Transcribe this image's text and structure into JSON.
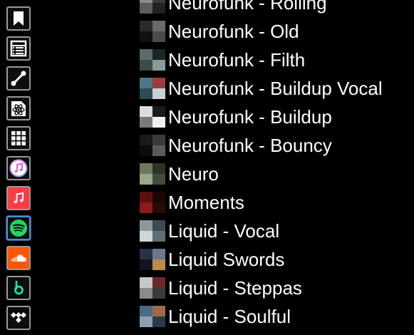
{
  "sidebar": {
    "buttons": [
      {
        "name": "bookmark-icon",
        "title": "Bookmarks",
        "bg": "#0d0d0d"
      },
      {
        "name": "list-icon",
        "title": "List",
        "bg": "#0d0d0d"
      },
      {
        "name": "connection-icon",
        "title": "Connections",
        "bg": "#0d0d0d"
      },
      {
        "name": "atom-icon",
        "title": "Atom",
        "bg": "#0d0d0d"
      },
      {
        "name": "grid-icon",
        "title": "Grid",
        "bg": "#0d0d0d"
      },
      {
        "name": "itunes-icon",
        "title": "iTunes",
        "bg": "#0d0d0d"
      },
      {
        "name": "apple-music-icon",
        "title": "Apple Music",
        "bg": "#fc3c44"
      },
      {
        "name": "spotify-icon",
        "title": "Spotify",
        "bg": "#0d0d0d",
        "active": true
      },
      {
        "name": "soundcloud-icon",
        "title": "SoundCloud",
        "bg": "#ff5500"
      },
      {
        "name": "beatport-icon",
        "title": "Beatport",
        "bg": "#0d0d0d"
      },
      {
        "name": "tidal-icon",
        "title": "Tidal",
        "bg": "#0d0d0d"
      }
    ]
  },
  "playlists": [
    {
      "label": "Neurofunk - Rolling",
      "colors": [
        "#8a8a8a",
        "#3a3a3a",
        "#5c5c5c",
        "#222222"
      ]
    },
    {
      "label": "Neurofunk - Old",
      "colors": [
        "#2a2a2a",
        "#6a6a6a",
        "#111111",
        "#4b4b4b"
      ]
    },
    {
      "label": "Neurofunk - Filth",
      "colors": [
        "#5d6b6a",
        "#1c2525",
        "#3c4a48",
        "#8a9a98"
      ]
    },
    {
      "label": "Neurofunk - Buildup Vocal",
      "colors": [
        "#4a7a86",
        "#a13a3a",
        "#2d4b55",
        "#c8d2d6"
      ]
    },
    {
      "label": "Neurofunk - Buildup",
      "colors": [
        "#dcdcdc",
        "#1a1a1a",
        "#7a7a7a",
        "#efefef"
      ]
    },
    {
      "label": "Neurofunk - Bouncy",
      "colors": [
        "#1a1a1a",
        "#3b3b3b",
        "#0c0c0c",
        "#5a5a5a"
      ]
    },
    {
      "label": "Neuro",
      "colors": [
        "#6b7a5a",
        "#2d3328",
        "#9aa58a",
        "#444c3a"
      ]
    },
    {
      "label": "Moments",
      "colors": [
        "#5a1010",
        "#1a0505",
        "#8a1c1c",
        "#2a0808"
      ]
    },
    {
      "label": "Liquid - Vocal",
      "colors": [
        "#8a9a9a",
        "#3d4a50",
        "#cfd6d8",
        "#5f6f72"
      ]
    },
    {
      "label": "Liquid Swords",
      "colors": [
        "#2a3344",
        "#6a7a8a",
        "#101520",
        "#c08a4a"
      ]
    },
    {
      "label": "Liquid - Steppas",
      "colors": [
        "#c8c8c8",
        "#6a2a2a",
        "#8a8a8a",
        "#3a3a3a"
      ]
    },
    {
      "label": "Liquid - Soulful",
      "colors": [
        "#4a6a8a",
        "#a06a4a",
        "#8aa0b0",
        "#2a3a4a"
      ]
    }
  ]
}
